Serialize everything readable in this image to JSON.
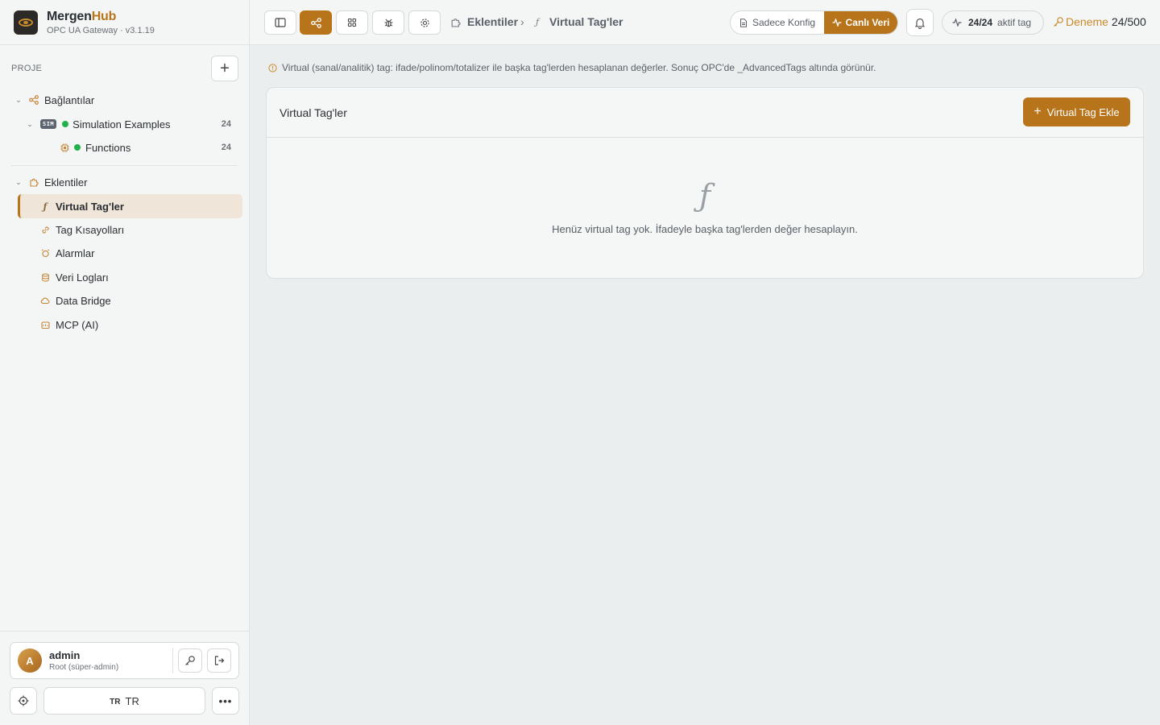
{
  "brand": {
    "name_main": "Mergen",
    "name_accent": "Hub",
    "subtitle": "OPC UA Gateway · v3.1.19"
  },
  "sidebar": {
    "project_label": "PROJE",
    "add_symbol": "+",
    "connections": {
      "label": "Bağlantılar"
    },
    "sim": {
      "badge": "SIM",
      "label": "Simulation Examples",
      "count": "24"
    },
    "functions": {
      "label": "Functions",
      "count": "24"
    },
    "plugins": {
      "label": "Eklentiler"
    },
    "items": [
      {
        "label": "Virtual Tag'ler",
        "icon": "function-icon"
      },
      {
        "label": "Tag Kısayolları",
        "icon": "link-icon"
      },
      {
        "label": "Alarmlar",
        "icon": "alarm-icon"
      },
      {
        "label": "Veri Logları",
        "icon": "database-icon"
      },
      {
        "label": "Data Bridge",
        "icon": "cloud-icon"
      },
      {
        "label": "MCP (AI)",
        "icon": "ai-icon"
      }
    ]
  },
  "user": {
    "initial": "A",
    "name": "admin",
    "role": "Root (süper-admin)"
  },
  "language": {
    "flag": "TR",
    "label": "TR"
  },
  "topbar": {
    "breadcrumb": {
      "parent": "Eklentiler",
      "separator": "›",
      "current": "Virtual Tag'ler"
    },
    "mode": {
      "config": "Sadece Konfig",
      "live": "Canlı Veri"
    },
    "tags": {
      "value": "24/24",
      "suffix": "aktif tag"
    },
    "trial": {
      "label": "Deneme",
      "value": "24/500"
    }
  },
  "main": {
    "info": "Virtual (sanal/analitik) tag: ifade/polinom/totalizer ile başka tag'lerden hesaplanan değerler. Sonuç OPC'de _AdvancedTags altında görünür.",
    "panel_title": "Virtual Tag'ler",
    "add_button": "Virtual Tag Ekle",
    "empty_text": "Henüz virtual tag yok. İfadeyle başka tag'lerden değer hesaplayın."
  },
  "colors": {
    "accent": "#b8741a",
    "online": "#22b04b"
  }
}
